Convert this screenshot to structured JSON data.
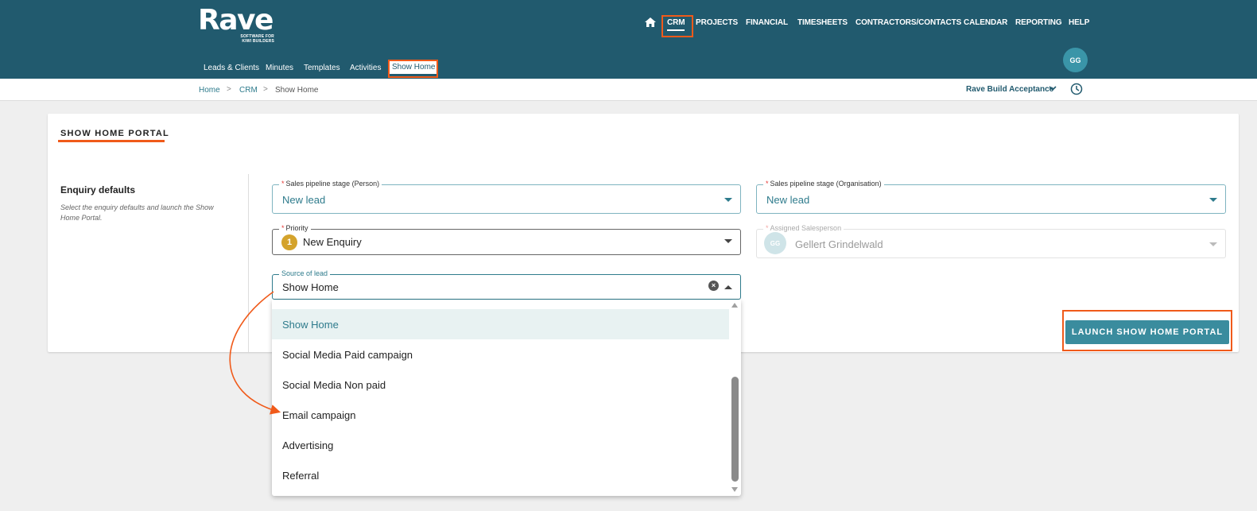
{
  "app": {
    "logo_text": "Rave",
    "logo_tagline": "SOFTWARE FOR KIWI BUILDERS"
  },
  "main_nav": {
    "items": [
      {
        "label": "CRM",
        "active": true
      },
      {
        "label": "PROJECTS"
      },
      {
        "label": "FINANCIAL"
      },
      {
        "label": "TIMESHEETS"
      },
      {
        "label": "CONTRACTORS/CONTACTS"
      },
      {
        "label": "CALENDAR"
      },
      {
        "label": "REPORTING"
      },
      {
        "label": "HELP"
      }
    ],
    "home_icon": "home-icon"
  },
  "sub_nav": {
    "items": [
      {
        "label": "Leads & Clients"
      },
      {
        "label": "Minutes"
      },
      {
        "label": "Templates"
      },
      {
        "label": "Activities"
      },
      {
        "label": "Show Home",
        "active": true
      }
    ]
  },
  "user": {
    "initials": "GG"
  },
  "breadcrumb": [
    "Home",
    "CRM",
    "Show Home"
  ],
  "breadcrumb_separator": ">",
  "environment": {
    "label": "Rave Build Acceptance",
    "icon": "chevron-down-icon"
  },
  "history_icon": "clock-icon",
  "page": {
    "title": "SHOW HOME PORTAL",
    "section_title": "Enquiry defaults",
    "section_description": "Select the enquiry defaults and launch the Show Home Portal."
  },
  "form": {
    "pipeline_person": {
      "label": "Sales pipeline stage (Person)",
      "value": "New lead",
      "required_mark": "*"
    },
    "pipeline_org": {
      "label": "Sales pipeline stage (Organisation)",
      "value": "New lead",
      "required_mark": "*"
    },
    "priority": {
      "label": "Priority",
      "value": "New Enquiry",
      "badge": "1",
      "required_mark": "*"
    },
    "salesperson": {
      "label": "Assigned Salesperson",
      "value": "Gellert Grindelwald",
      "initials": "GG",
      "required_mark": "*"
    },
    "source": {
      "label": "Source of lead",
      "value": "Show Home",
      "clear_glyph": "×"
    }
  },
  "source_options": [
    {
      "label": "Show Home",
      "selected": true
    },
    {
      "label": "Social Media Paid campaign"
    },
    {
      "label": "Social Media Non paid"
    },
    {
      "label": "Email campaign"
    },
    {
      "label": "Advertising"
    },
    {
      "label": "Referral"
    }
  ],
  "launch_button": {
    "label": "LAUNCH SHOW HOME PORTAL"
  },
  "colors": {
    "header_bg": "#215a6e",
    "accent": "#2e7b8c",
    "button": "#3a8c9e",
    "highlight": "#f05a1a",
    "priority_badge": "#d4a32c"
  }
}
